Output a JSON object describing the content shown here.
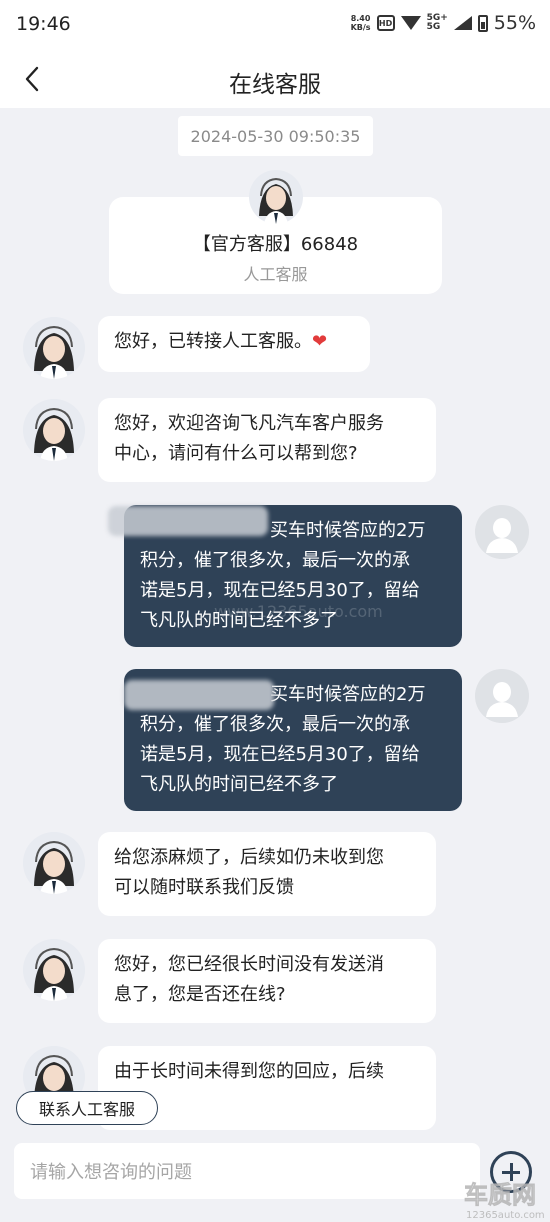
{
  "status_bar": {
    "time": "19:46",
    "net_speed_value": "8.40",
    "net_speed_unit": "KB/s",
    "hd_label": "HD",
    "net_type_top": "5G+",
    "net_type_bottom": "5G",
    "battery": "55%"
  },
  "header": {
    "title": "在线客服"
  },
  "chat": {
    "timestamp": "2024-05-30 09:50:35",
    "agent_card": {
      "name": "【官方客服】66848",
      "role": "人工客服"
    },
    "messages": [
      {
        "from": "agent",
        "lines": [
          "您好，已转接人工客服。"
        ],
        "emoji": "❤"
      },
      {
        "from": "agent",
        "lines": [
          "您好，欢迎咨询飞凡汽车客户服务",
          "中心，请问有什么可以帮到您?"
        ]
      },
      {
        "from": "user",
        "lines": [
          "买车时候答应的2万",
          "积分，催了很多次，最后一次的承",
          "诺是5月，现在已经5月30了，留给",
          "飞凡队的时间已经不多了"
        ]
      },
      {
        "from": "user",
        "lines": [
          "买车时候答应的2万",
          "积分，催了很多次，最后一次的承",
          "诺是5月，现在已经5月30了，留给",
          "飞凡队的时间已经不多了"
        ]
      },
      {
        "from": "agent",
        "lines": [
          "给您添麻烦了，后续如仍未收到您",
          "可以随时联系我们反馈"
        ]
      },
      {
        "from": "agent",
        "lines": [
          "您好，您已经很长时间没有发送消",
          "息了，您是否还在线?"
        ]
      },
      {
        "from": "agent",
        "lines": [
          "由于长时间未得到您的回应，后续"
        ]
      }
    ]
  },
  "contact_button": {
    "label": "联系人工客服"
  },
  "input": {
    "placeholder": "请输入想咨询的问题"
  },
  "colors": {
    "user_bubble": "#2f4257",
    "chat_bg": "#f0f1f5",
    "heart": "#e23b3b"
  },
  "icons": [
    "back-chevron-icon",
    "add-circle-icon",
    "wifi-icon",
    "battery-icon"
  ]
}
